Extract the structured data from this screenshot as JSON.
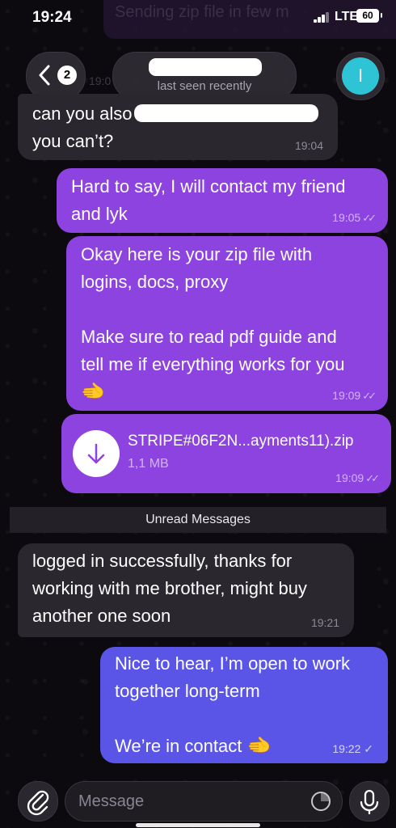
{
  "status_bar": {
    "time": "19:24",
    "network": "LTE",
    "battery": "60",
    "behind_notification": "Sending zip file in few m"
  },
  "header": {
    "back_badge": "2",
    "contact_name": "█████████",
    "subtitle": "last seen recently",
    "avatar_letter": "I",
    "avatar_color": "#2ec4d6",
    "date_peek": "19:0"
  },
  "messages": [
    {
      "id": "m1",
      "direction": "incoming",
      "text_before_redaction": "can you also",
      "text_after": "you can’t?",
      "time": "19:04"
    },
    {
      "id": "m2",
      "direction": "outgoing",
      "text": "Hard to say, I will contact my friend\nand lyk",
      "time": "19:05",
      "status": "read"
    },
    {
      "id": "m3",
      "direction": "outgoing",
      "text": "Okay here is your zip file with\nlogins, docs, proxy\n\nMake sure to read pdf guide and\ntell me if everything works for you",
      "emoji": "🫲",
      "time": "19:09",
      "status": "read"
    },
    {
      "id": "m4",
      "direction": "outgoing",
      "type": "file",
      "file_name": "STRIPE#06F2N...ayments11).zip",
      "file_size": "1,1 MB",
      "time": "19:09",
      "status": "read"
    },
    {
      "id": "m5",
      "direction": "incoming",
      "text": "logged in successfully, thanks for\nworking with me brother, might buy\nanother one soon",
      "time": "19:21"
    },
    {
      "id": "m6",
      "direction": "outgoing",
      "text": "Nice to hear, I’m open to work\ntogether long-term\n\nWe’re in contact",
      "emoji": "🫲",
      "time": "19:22",
      "status": "sent"
    }
  ],
  "divider": {
    "label": "Unread Messages"
  },
  "composer": {
    "placeholder": "Message"
  },
  "colors": {
    "background": "#0c0a0f",
    "incoming_bubble": "#2a272e",
    "outgoing_bubble": "#8d43e0",
    "outgoing_bubble_last": "#5a55e6"
  },
  "icons": {
    "back": "chevron-left-icon",
    "download": "download-arrow-icon",
    "attach": "paperclip-icon",
    "sticker": "sticker-icon",
    "mic": "microphone-icon",
    "read_receipt": "double-check-icon",
    "sent_receipt": "check-icon"
  }
}
